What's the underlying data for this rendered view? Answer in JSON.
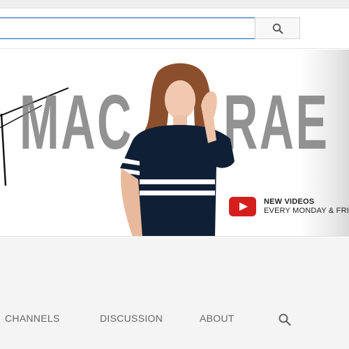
{
  "masthead": {
    "search": {
      "placeholder": "",
      "value": ""
    },
    "search_button_icon": "search-icon"
  },
  "banner": {
    "big_text_left": "MAC",
    "big_text_right": "RAE",
    "promo": {
      "icon": "youtube-play-logo",
      "title": "NEW VIDEOS",
      "subtitle": "EVERY MONDAY & FRI"
    }
  },
  "tabs": {
    "items": [
      {
        "label": "CHANNELS"
      },
      {
        "label": "DISCUSSION"
      },
      {
        "label": "ABOUT"
      }
    ],
    "search_icon": "search-icon"
  },
  "colors": {
    "accent_red": "#d51f1f",
    "input_border": "#1c62b9",
    "tab_text": "#666666",
    "channel_bg": "#f4f4f4"
  }
}
